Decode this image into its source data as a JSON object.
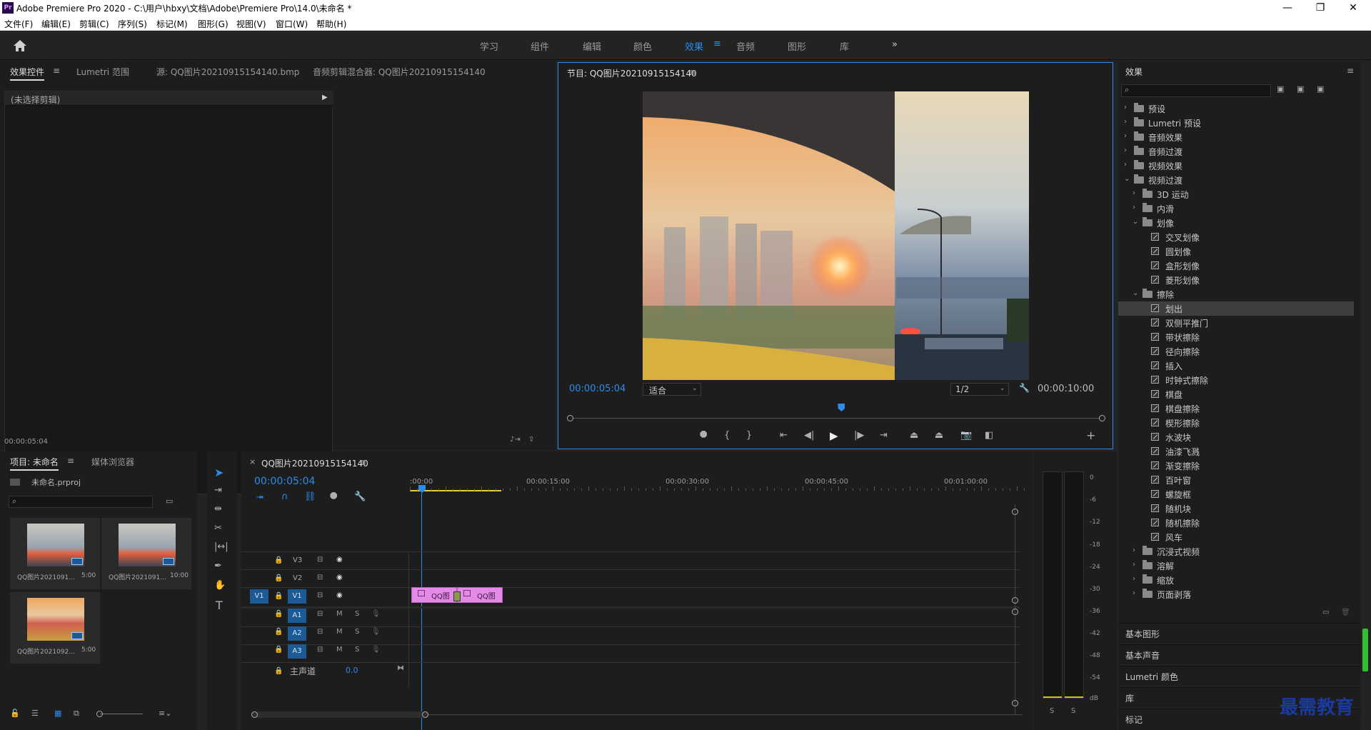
{
  "window": {
    "title": "Adobe Premiere Pro 2020 - C:\\用户\\hbxy\\文档\\Adobe\\Premiere Pro\\14.0\\未命名 *",
    "app_icon": "Pr"
  },
  "window_controls": {
    "minimize": "—",
    "maximize": "❐",
    "close": "✕"
  },
  "menu": [
    "文件(F)",
    "编辑(E)",
    "剪辑(C)",
    "序列(S)",
    "标记(M)",
    "图形(G)",
    "视图(V)",
    "窗口(W)",
    "帮助(H)"
  ],
  "workspaces": {
    "items": [
      "学习",
      "组件",
      "编辑",
      "颜色",
      "效果",
      "音频",
      "图形",
      "库"
    ],
    "active": "效果",
    "more": "»"
  },
  "source_panel": {
    "tabs": [
      "效果控件",
      "Lumetri 范围",
      "源: QQ图片20210915154140.bmp",
      "音频剪辑混合器: QQ图片20210915154140"
    ],
    "no_clip": "(未选择剪辑)",
    "timecode": "00:00:05:04"
  },
  "program": {
    "title": "节目: QQ图片20210915154140",
    "timecode": "00:00:05:04",
    "fit": "适合",
    "resolution": "1/2",
    "duration": "00:00:10:00",
    "playhead_fraction": 0.51
  },
  "project": {
    "tabs": [
      "项目: 未命名",
      "媒体浏览器"
    ],
    "file": "未命名.prproj",
    "items": [
      {
        "name": "QQ图片2021091...",
        "duration": "5:00"
      },
      {
        "name": "QQ图片2021091...",
        "duration": "10:00"
      },
      {
        "name": "QQ图片2021092...",
        "duration": "5:00"
      }
    ]
  },
  "timeline": {
    "tab": "QQ图片20210915154140",
    "timecode": "00:00:05:04",
    "ruler": [
      ":00:00",
      "00:00:15:00",
      "00:00:30:00",
      "00:00:45:00",
      "00:01:00:00"
    ],
    "video_tracks": [
      "V3",
      "V2",
      "V1"
    ],
    "audio_tracks": [
      "A1",
      "A2",
      "A3"
    ],
    "source_patch": "V1",
    "master": {
      "label": "主声道",
      "value": "0.0"
    },
    "track_buttons": {
      "mute": "M",
      "solo": "S"
    },
    "clips": [
      {
        "label": "QQ图"
      },
      {
        "label": "QQ图"
      }
    ]
  },
  "meter": {
    "scale": [
      "0",
      "-6",
      "-12",
      "-18",
      "-24",
      "-30",
      "-36",
      "-42",
      "-48",
      "-54",
      "dB"
    ],
    "solo": [
      "S",
      "S"
    ]
  },
  "effects": {
    "title": "效果",
    "tree": [
      {
        "label": "预设",
        "level": 0,
        "type": "folder",
        "open": false
      },
      {
        "label": "Lumetri 预设",
        "level": 0,
        "type": "folder",
        "open": false
      },
      {
        "label": "音频效果",
        "level": 0,
        "type": "folder",
        "open": false
      },
      {
        "label": "音频过渡",
        "level": 0,
        "type": "folder",
        "open": false
      },
      {
        "label": "视频效果",
        "level": 0,
        "type": "folder",
        "open": false
      },
      {
        "label": "视频过渡",
        "level": 0,
        "type": "folder",
        "open": true
      },
      {
        "label": "3D 运动",
        "level": 1,
        "type": "folder",
        "open": false
      },
      {
        "label": "内滑",
        "level": 1,
        "type": "folder",
        "open": false
      },
      {
        "label": "划像",
        "level": 1,
        "type": "folder",
        "open": true
      },
      {
        "label": "交叉划像",
        "level": 2,
        "type": "fx"
      },
      {
        "label": "圆划像",
        "level": 2,
        "type": "fx"
      },
      {
        "label": "盒形划像",
        "level": 2,
        "type": "fx"
      },
      {
        "label": "菱形划像",
        "level": 2,
        "type": "fx"
      },
      {
        "label": "擦除",
        "level": 1,
        "type": "folder",
        "open": true
      },
      {
        "label": "划出",
        "level": 2,
        "type": "fx",
        "selected": true
      },
      {
        "label": "双侧平推门",
        "level": 2,
        "type": "fx"
      },
      {
        "label": "带状擦除",
        "level": 2,
        "type": "fx"
      },
      {
        "label": "径向擦除",
        "level": 2,
        "type": "fx"
      },
      {
        "label": "插入",
        "level": 2,
        "type": "fx"
      },
      {
        "label": "时钟式擦除",
        "level": 2,
        "type": "fx"
      },
      {
        "label": "棋盘",
        "level": 2,
        "type": "fx"
      },
      {
        "label": "棋盘擦除",
        "level": 2,
        "type": "fx"
      },
      {
        "label": "楔形擦除",
        "level": 2,
        "type": "fx"
      },
      {
        "label": "水波块",
        "level": 2,
        "type": "fx"
      },
      {
        "label": "油漆飞溅",
        "level": 2,
        "type": "fx"
      },
      {
        "label": "渐变擦除",
        "level": 2,
        "type": "fx"
      },
      {
        "label": "百叶窗",
        "level": 2,
        "type": "fx"
      },
      {
        "label": "螺旋框",
        "level": 2,
        "type": "fx"
      },
      {
        "label": "随机块",
        "level": 2,
        "type": "fx"
      },
      {
        "label": "随机擦除",
        "level": 2,
        "type": "fx"
      },
      {
        "label": "风车",
        "level": 2,
        "type": "fx"
      },
      {
        "label": "沉浸式视频",
        "level": 1,
        "type": "folder",
        "open": false
      },
      {
        "label": "溶解",
        "level": 1,
        "type": "folder",
        "open": false
      },
      {
        "label": "缩放",
        "level": 1,
        "type": "folder",
        "open": false
      },
      {
        "label": "页面剥落",
        "level": 1,
        "type": "folder",
        "open": false
      }
    ],
    "sections": [
      "基本图形",
      "基本声音",
      "Lumetri 颜色",
      "库",
      "标记"
    ]
  },
  "watermark": "最需教育",
  "colors": {
    "accent": "#2d8ceb",
    "clip": "#e48ae8",
    "track_blue": "#1b5a95",
    "bg": "#232323"
  }
}
